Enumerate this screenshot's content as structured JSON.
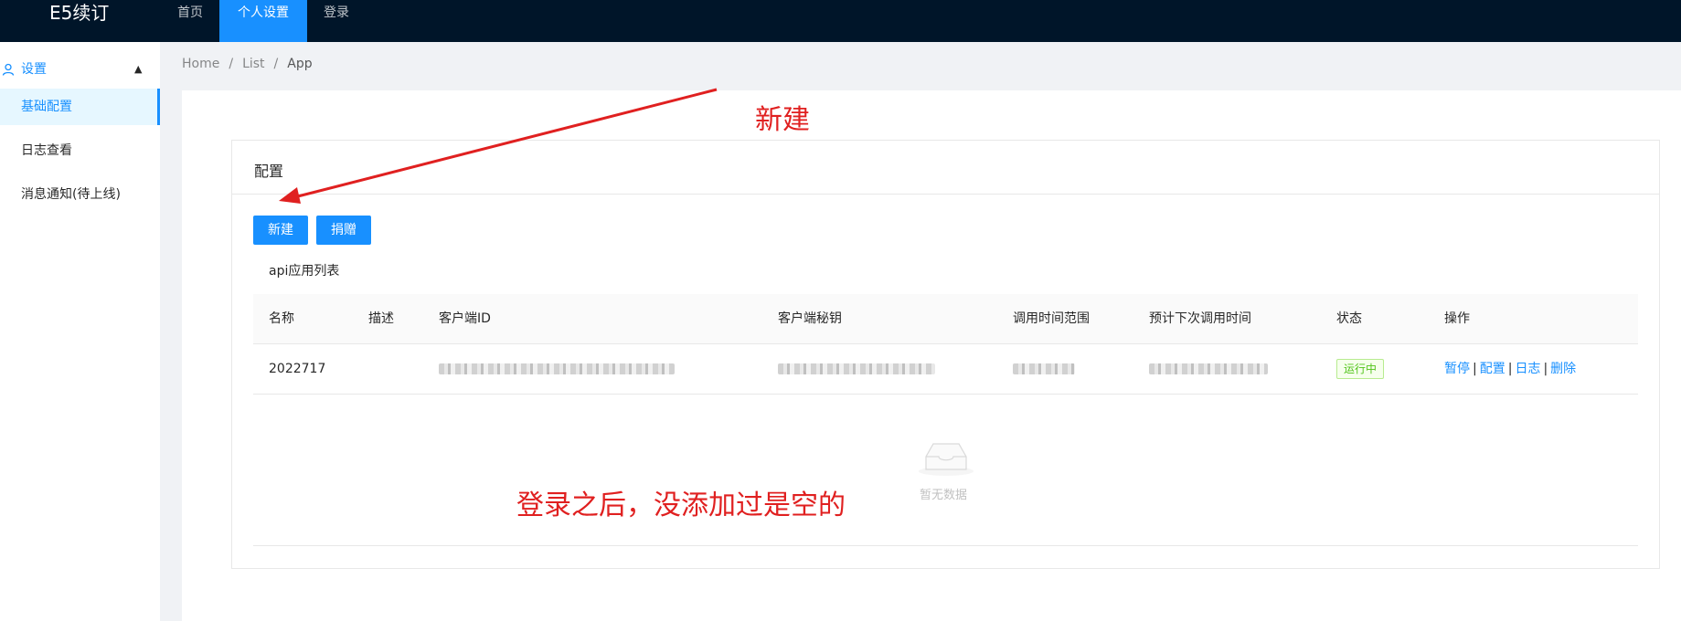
{
  "app": {
    "title": "E5续订"
  },
  "topnav": {
    "items": [
      "首页",
      "个人设置",
      "登录"
    ]
  },
  "sidebar": {
    "group_label": "设置",
    "items": [
      {
        "label": "基础配置"
      },
      {
        "label": "日志查看"
      },
      {
        "label": "消息通知(待上线)"
      }
    ]
  },
  "breadcrumb": [
    "Home",
    "List",
    "App"
  ],
  "card": {
    "title": "配置",
    "buttons": {
      "new": "新建",
      "donate": "捐赠"
    },
    "list_title": "api应用列表"
  },
  "table": {
    "columns": [
      "名称",
      "描述",
      "客户端ID",
      "客户端秘钥",
      "调用时间范围",
      "预计下次调用时间",
      "状态",
      "操作"
    ],
    "rows": [
      {
        "name": "2022717",
        "description": "",
        "status": "运行中",
        "actions": [
          "暂停",
          "配置",
          "日志",
          "删除"
        ]
      }
    ],
    "empty_text": "暂无数据"
  },
  "annotations": {
    "new_label": "新建",
    "empty_note": "登录之后，没添加过是空的"
  },
  "colors": {
    "primary": "#1890ff",
    "header_bg": "#001529",
    "annotation": "#e02020",
    "success": "#52c41a"
  }
}
